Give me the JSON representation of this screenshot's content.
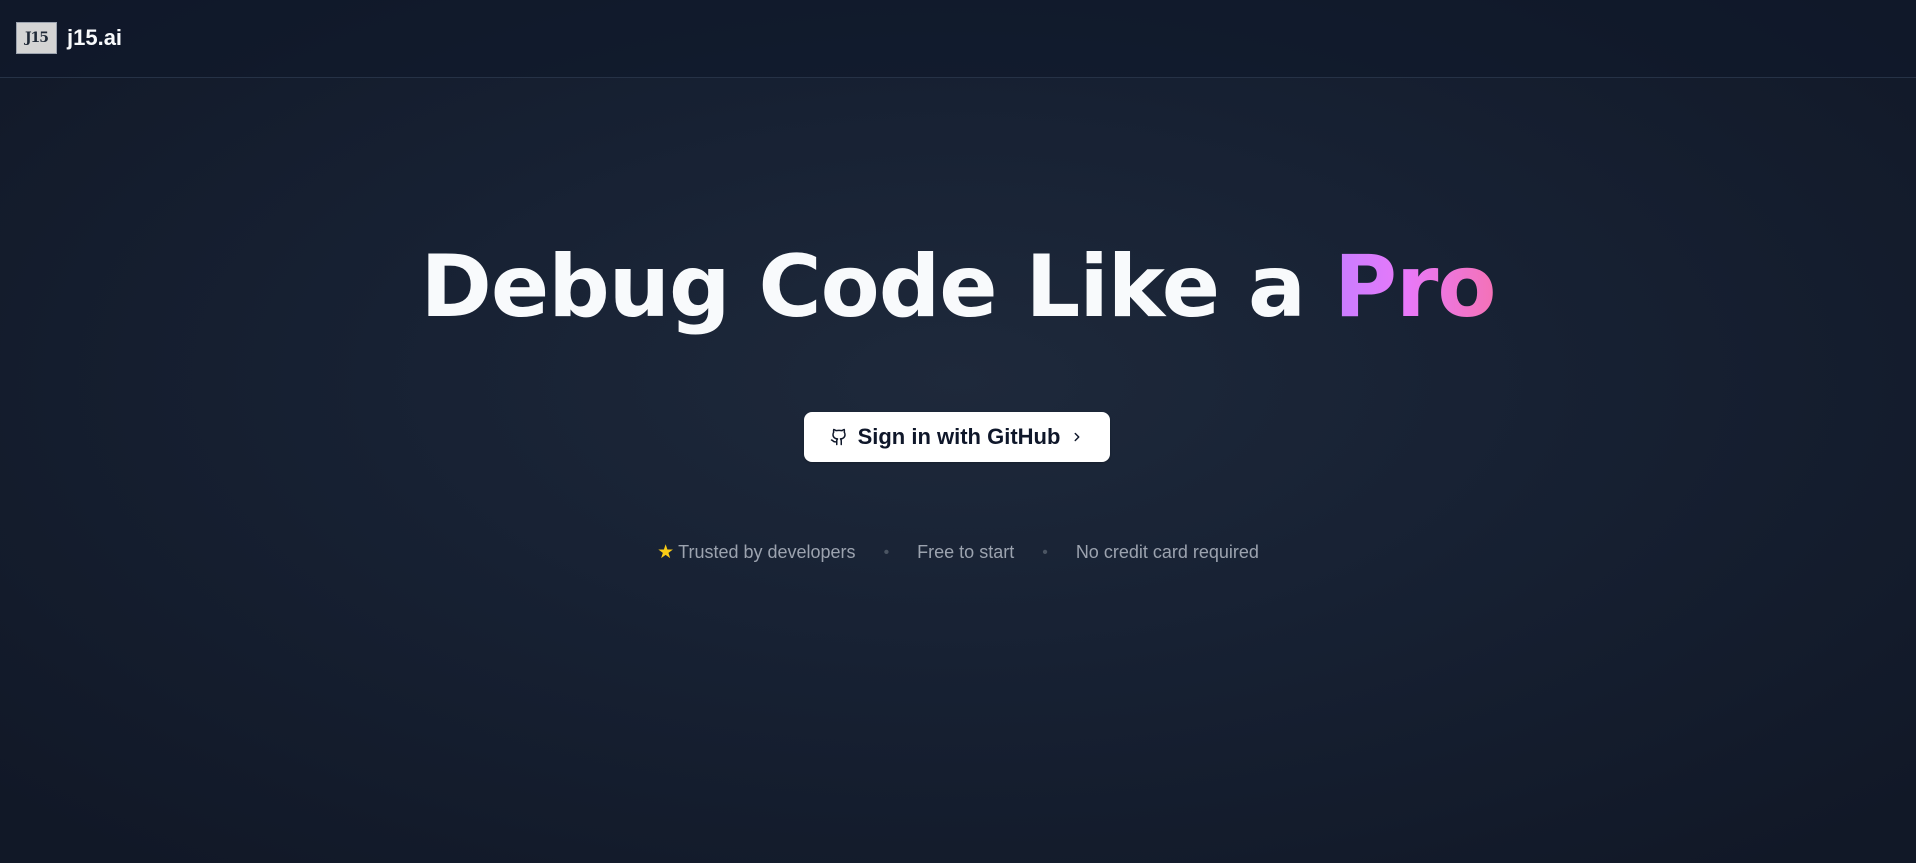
{
  "navbar": {
    "logo_text": "J15",
    "brand_name": "j15.ai"
  },
  "hero": {
    "title_main": "Debug Code Like a",
    "title_highlight": "Pro",
    "highlight_gradient": [
      "#c77dff",
      "#e879f9",
      "#f472b6"
    ]
  },
  "cta": {
    "label": "Sign in with GitHub",
    "icon": "github-icon",
    "trailing_icon": "chevron-right-icon"
  },
  "trust": {
    "items": [
      {
        "icon": "star-icon",
        "label": "Trusted by developers"
      },
      {
        "label": "Free to start"
      },
      {
        "label": "No credit card required"
      }
    ],
    "separator": "•"
  },
  "colors": {
    "background": "#111827",
    "text_primary": "#f8fafc",
    "text_muted": "#9ca3af",
    "star": "#facc15",
    "button_bg": "#ffffff"
  }
}
